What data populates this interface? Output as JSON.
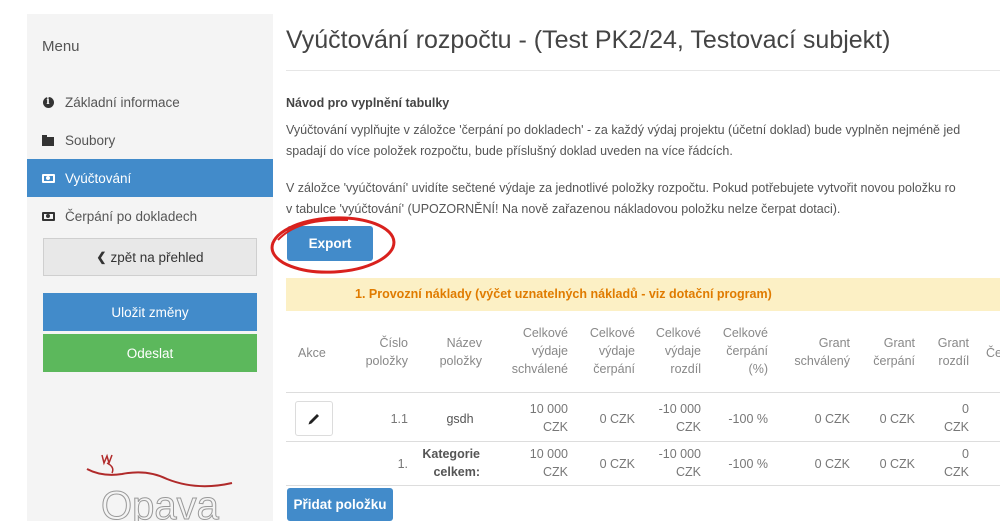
{
  "sidebar": {
    "menu_title": "Menu",
    "items": [
      {
        "label": "Základní informace",
        "icon": "info-circle-icon"
      },
      {
        "label": "Soubory",
        "icon": "folder-icon"
      },
      {
        "label": "Vyúčtování",
        "icon": "money-icon",
        "active": true
      },
      {
        "label": "Čerpání po dokladech",
        "icon": "money-icon"
      }
    ],
    "back_label": "zpět na přehled",
    "save_label": "Uložit změny",
    "send_label": "Odeslat",
    "logo_text": "Opava"
  },
  "page": {
    "title": "Vyúčtování rozpočtu - (Test PK2/24, Testovací subjekt)",
    "instructions_heading": "Návod pro vyplnění tabulky",
    "para1_line1": "Vyúčtování vyplňujte v záložce 'čerpání po dokladech' - za každý výdaj projektu (účetní doklad) bude vyplněn nejméně jed",
    "para1_line2": "spadají do více položek rozpočtu, bude příslušný doklad uveden na více řádcích.",
    "para2_line1": "V záložce 'vyúčtování' uvidíte sečtené výdaje za jednotlivé položky rozpočtu. Pokud potřebujete vytvořit novou položku ro",
    "para2_line2": "v tabulce 'vyúčtování' (UPOZORNĚNÍ! Na nově zařazenou nákladovou položku nelze čerpat dotaci).",
    "export_label": "Export",
    "add_item_label": "Přidat položku"
  },
  "category": {
    "title": "1. Provozní náklady (výčet uznatelných nákladů - viz dotační program)"
  },
  "table": {
    "headers": {
      "akce": "Akce",
      "cislo": [
        "Číslo",
        "položky"
      ],
      "nazev": [
        "Název",
        "položky"
      ],
      "vydaje_schvalene": [
        "Celkové",
        "výdaje",
        "schválené"
      ],
      "vydaje_cerpani": [
        "Celkové",
        "výdaje",
        "čerpání"
      ],
      "vydaje_rozdil": [
        "Celkové",
        "výdaje",
        "rozdíl"
      ],
      "cerpani_pct": [
        "Celkové",
        "čerpání",
        "(%)"
      ],
      "grant_schvaleny": [
        "Grant",
        "schválený"
      ],
      "grant_cerpani": [
        "Grant",
        "čerpání"
      ],
      "grant_rozdil": [
        "Grant",
        "rozdíl"
      ],
      "next_col_partial": "Če"
    },
    "rows": [
      {
        "cislo": "1.1",
        "nazev": "gsdh",
        "schvalene": [
          "10 000",
          "CZK"
        ],
        "cerpani": "0 CZK",
        "rozdil": [
          "-10 000",
          "CZK"
        ],
        "pct": "-100 %",
        "grant_schvaleny": "0 CZK",
        "grant_cerpani": "0 CZK",
        "grant_rozdil": [
          "0",
          "CZK"
        ]
      },
      {
        "cislo": "1.",
        "nazev": [
          "Kategorie",
          "celkem:"
        ],
        "schvalene": [
          "10 000",
          "CZK"
        ],
        "cerpani": "0 CZK",
        "rozdil": [
          "-10 000",
          "CZK"
        ],
        "pct": "-100 %",
        "grant_schvaleny": "0 CZK",
        "grant_cerpani": "0 CZK",
        "grant_rozdil": [
          "0",
          "CZK"
        ]
      }
    ]
  },
  "colors": {
    "primary": "#428bca",
    "success": "#5cb85c",
    "warning_bg": "#fcf0c5",
    "warning_text": "#e07b00",
    "annotation": "#d9211d"
  }
}
